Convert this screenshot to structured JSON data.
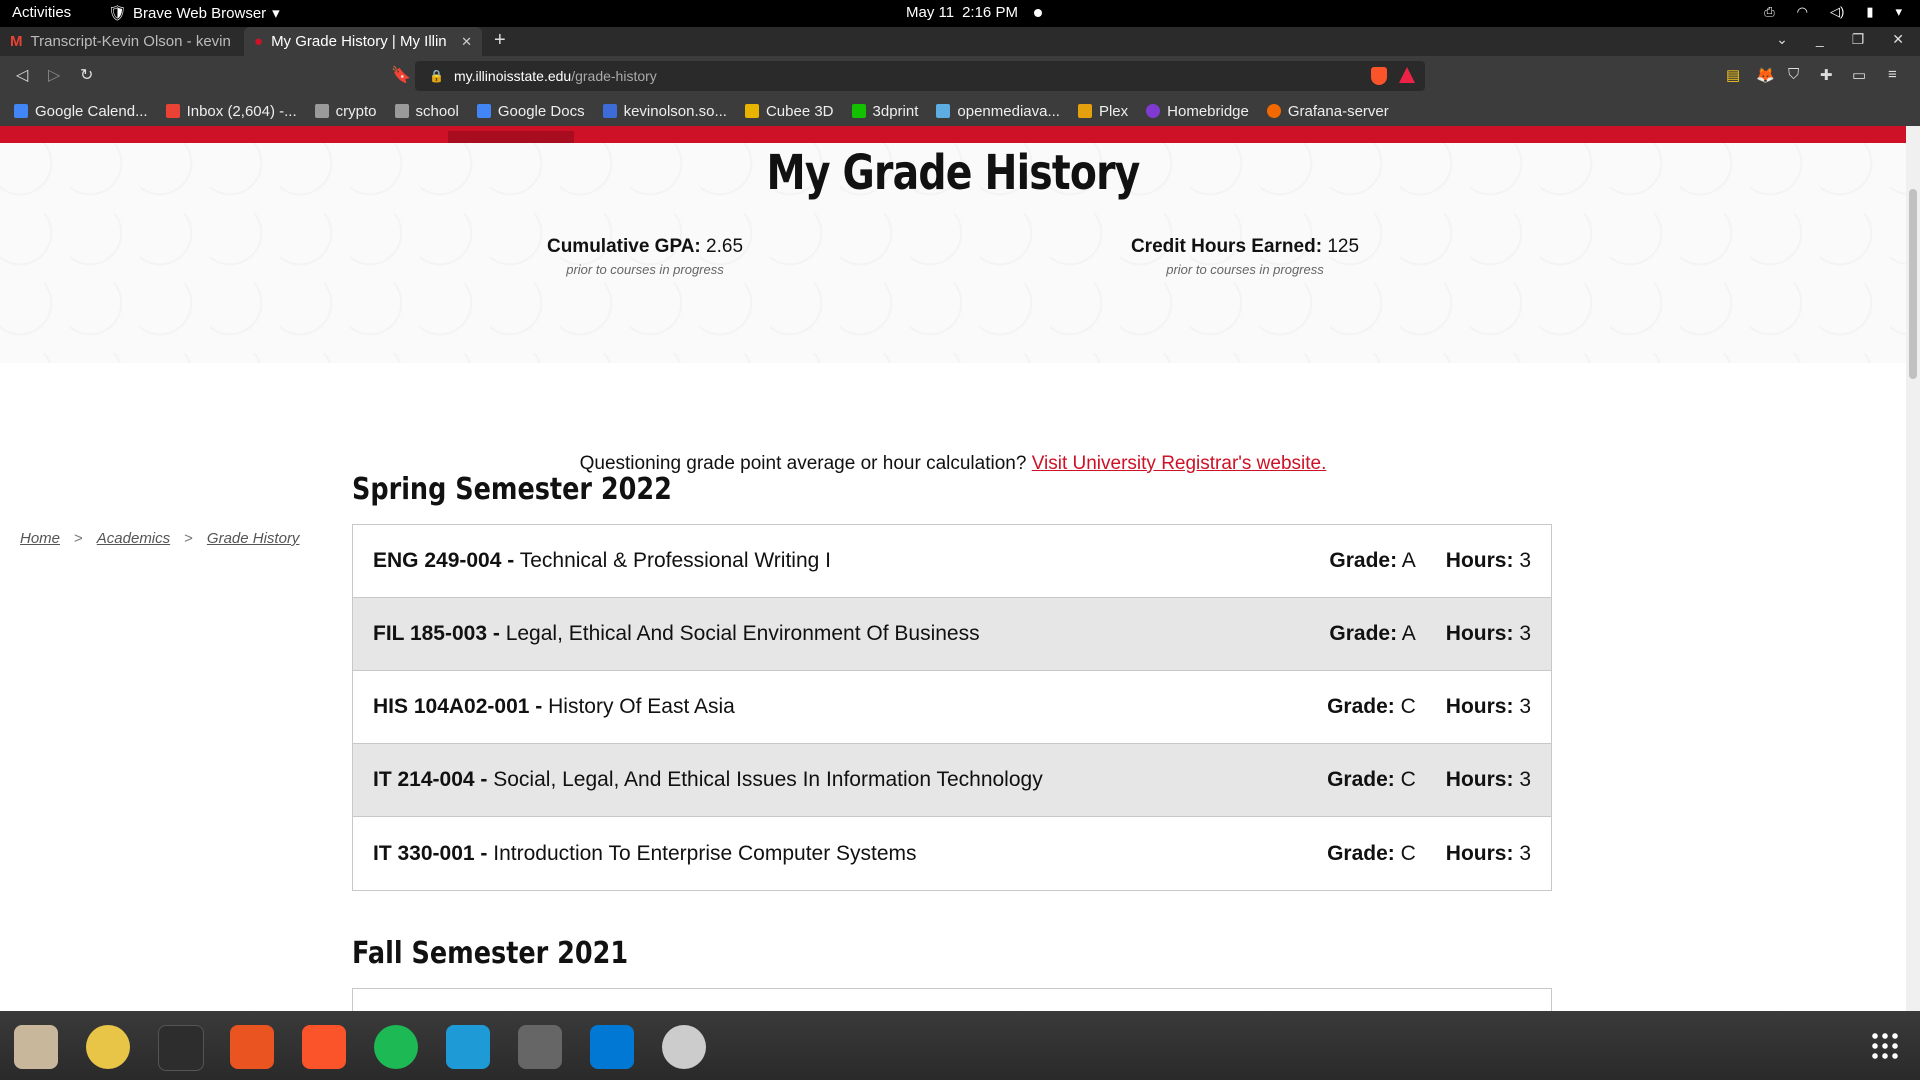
{
  "system": {
    "activities": "Activities",
    "app_name": "Brave Web Browser",
    "date": "May 11",
    "time": "2:16 PM"
  },
  "browser": {
    "tabs": [
      {
        "title": "Transcript-Kevin Olson - kevin",
        "active": false
      },
      {
        "title": "My Grade History | My Illin",
        "active": true
      }
    ],
    "url_domain": "my.illinoisstate.edu",
    "url_path": "/grade-history",
    "bookmarks": [
      {
        "label": "Google Calend...",
        "icon": "calendar-icon",
        "color": "#4285f4"
      },
      {
        "label": "Inbox (2,604) -...",
        "icon": "gmail-icon",
        "color": "#ea4335"
      },
      {
        "label": "crypto",
        "icon": "folder-icon",
        "color": "#9a9a9a"
      },
      {
        "label": "school",
        "icon": "folder-icon",
        "color": "#9a9a9a"
      },
      {
        "label": "Google Docs",
        "icon": "docs-icon",
        "color": "#4285f4"
      },
      {
        "label": "kevinolson.so...",
        "icon": "s-icon",
        "color": "#3d6bd8"
      },
      {
        "label": "Cubee 3D",
        "icon": "cubee-icon",
        "color": "#e8b400"
      },
      {
        "label": "3dprint",
        "icon": "octoprint-icon",
        "color": "#13c100"
      },
      {
        "label": "openmediava...",
        "icon": "omv-icon",
        "color": "#5dade2"
      },
      {
        "label": "Plex",
        "icon": "plex-icon",
        "color": "#e5a00d"
      },
      {
        "label": "Homebridge",
        "icon": "homebridge-icon",
        "color": "#7f3bd1"
      },
      {
        "label": "Grafana-server",
        "icon": "grafana-icon",
        "color": "#f46800"
      }
    ]
  },
  "page": {
    "title": "My Grade History",
    "gpa_label": "Cumulative GPA:",
    "gpa_value": "2.65",
    "gpa_note": "prior to courses in progress",
    "hours_label": "Credit Hours Earned:",
    "hours_value": "125",
    "hours_note": "prior to courses in progress",
    "question_text": "Questioning grade point average or hour calculation?",
    "question_link": "Visit University Registrar's website.",
    "breadcrumb": [
      "Home",
      "Academics",
      "Grade History"
    ],
    "grade_label": "Grade:",
    "hours_col_label": "Hours:"
  },
  "semesters": [
    {
      "title": "Spring Semester 2022",
      "courses": [
        {
          "code": "ENG 249-004 -",
          "name": "Technical & Professional Writing I",
          "grade": "A",
          "hours": "3"
        },
        {
          "code": "FIL 185-003 -",
          "name": "Legal, Ethical And Social Environment Of Business",
          "grade": "A",
          "hours": "3"
        },
        {
          "code": "HIS 104A02-001 -",
          "name": "History Of East Asia",
          "grade": "C",
          "hours": "3"
        },
        {
          "code": "IT 214-004 -",
          "name": "Social, Legal, And Ethical Issues In Information Technology",
          "grade": "C",
          "hours": "3"
        },
        {
          "code": "IT 330-001 -",
          "name": "Introduction To Enterprise Computer Systems",
          "grade": "C",
          "hours": "3"
        }
      ]
    },
    {
      "title": "Fall Semester 2021",
      "courses": []
    }
  ],
  "dock": [
    {
      "name": "files-icon",
      "color": "#c9b79c"
    },
    {
      "name": "rhythmbox-icon",
      "color": "#e8c547"
    },
    {
      "name": "terminal-icon",
      "color": "#2d2d2d"
    },
    {
      "name": "app-store-icon",
      "color": "#e95420"
    },
    {
      "name": "brave-icon",
      "color": "#fb542b"
    },
    {
      "name": "spotify-icon",
      "color": "#1db954"
    },
    {
      "name": "cura-icon",
      "color": "#1e9bd7"
    },
    {
      "name": "inkscape-icon",
      "color": "#666666"
    },
    {
      "name": "vscode-icon",
      "color": "#0078d4"
    },
    {
      "name": "updater-icon",
      "color": "#cccccc"
    }
  ],
  "colors": {
    "accent_red": "#ce1126",
    "row_alt": "#e6e6e6"
  }
}
